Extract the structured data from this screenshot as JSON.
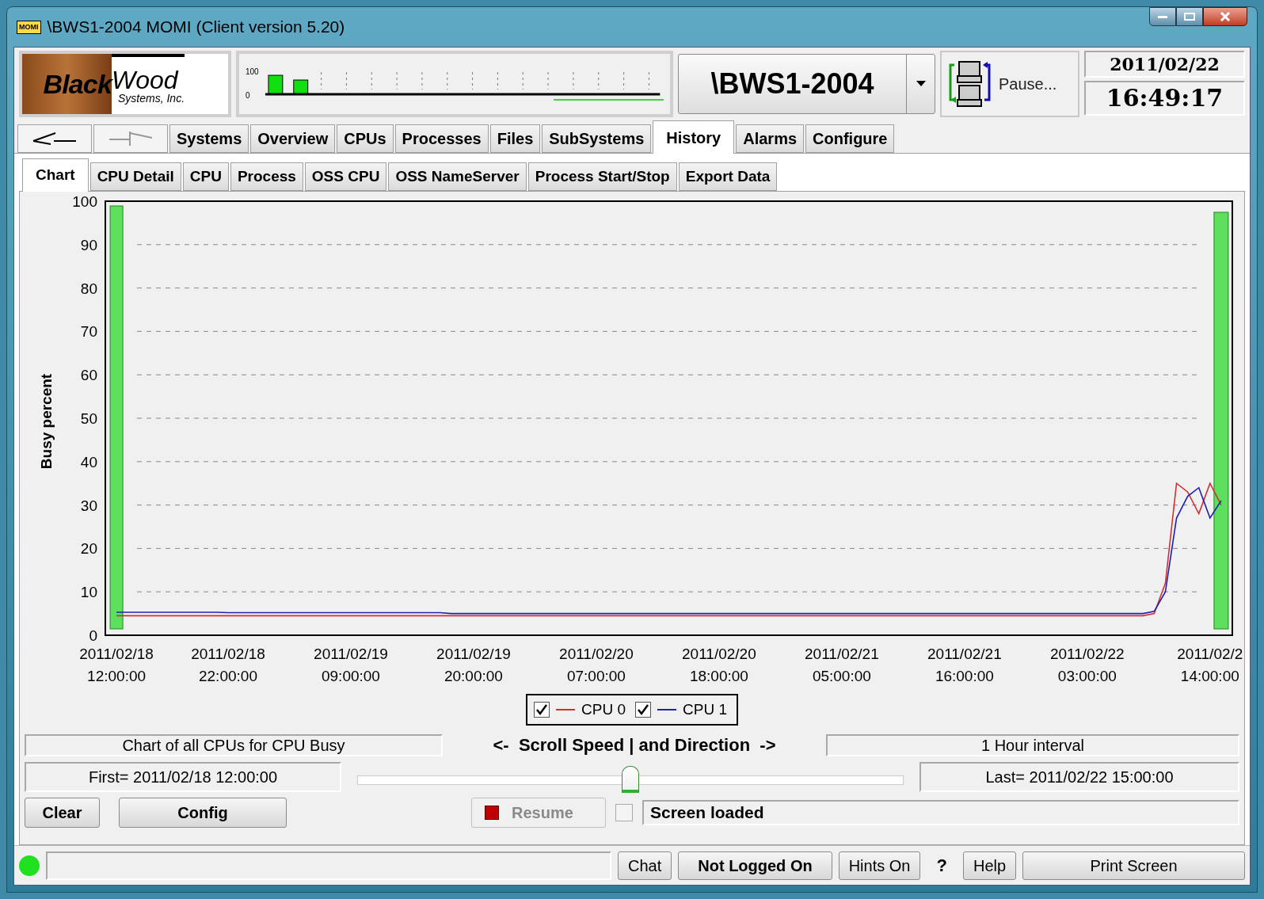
{
  "window": {
    "title": "\\BWS1-2004 MOMI (Client version 5.20)",
    "app_icon_text": "MOMI"
  },
  "header": {
    "logo": {
      "word_1": "Black",
      "word_2": "Wood",
      "tagline": "Systems, Inc."
    },
    "mini_chart": {
      "max_label": "100",
      "min_label": "0"
    },
    "system": {
      "value": "\\BWS1-2004"
    },
    "pause_button": {
      "label": "Pause..."
    },
    "date": "2011/02/22",
    "time": "16:49:17"
  },
  "tabs": [
    {
      "label": "Systems",
      "selected": false
    },
    {
      "label": "Overview",
      "selected": false
    },
    {
      "label": "CPUs",
      "selected": false
    },
    {
      "label": "Processes",
      "selected": false
    },
    {
      "label": "Files",
      "selected": false
    },
    {
      "label": "SubSystems",
      "selected": false
    },
    {
      "label": "History",
      "selected": true
    },
    {
      "label": "Alarms",
      "selected": false
    },
    {
      "label": "Configure",
      "selected": false
    }
  ],
  "subtabs": [
    {
      "label": "Chart",
      "selected": true
    },
    {
      "label": "CPU Detail",
      "selected": false
    },
    {
      "label": "CPU",
      "selected": false
    },
    {
      "label": "Process",
      "selected": false
    },
    {
      "label": "OSS CPU",
      "selected": false
    },
    {
      "label": "OSS NameServer",
      "selected": false
    },
    {
      "label": "Process Start/Stop",
      "selected": false
    },
    {
      "label": "Export Data",
      "selected": false
    }
  ],
  "legend_checkboxes": [
    {
      "checked": true
    },
    {
      "checked": true
    }
  ],
  "chart_data": {
    "type": "line",
    "grid": true,
    "legend": true,
    "ylabel": "Busy percent",
    "ylim": [
      0,
      100
    ],
    "yticks": [
      0,
      10,
      20,
      30,
      40,
      50,
      60,
      70,
      80,
      90,
      100
    ],
    "categories": [
      "2011/02/18 12:00:00",
      null,
      null,
      null,
      null,
      null,
      null,
      null,
      null,
      null,
      "2011/02/18 22:00:00",
      null,
      null,
      null,
      null,
      null,
      null,
      null,
      null,
      null,
      null,
      "2011/02/19 09:00:00",
      null,
      null,
      null,
      null,
      null,
      null,
      null,
      null,
      null,
      null,
      "2011/02/19 20:00:00",
      null,
      null,
      null,
      null,
      null,
      null,
      null,
      null,
      null,
      null,
      "2011/02/20 07:00:00",
      null,
      null,
      null,
      null,
      null,
      null,
      null,
      null,
      null,
      null,
      "2011/02/20 18:00:00",
      null,
      null,
      null,
      null,
      null,
      null,
      null,
      null,
      null,
      null,
      "2011/02/21 05:00:00",
      null,
      null,
      null,
      null,
      null,
      null,
      null,
      null,
      null,
      null,
      "2011/02/21 16:00:00",
      null,
      null,
      null,
      null,
      null,
      null,
      null,
      null,
      null,
      null,
      "2011/02/22 03:00:00",
      null,
      null,
      null,
      null,
      null,
      null,
      null,
      null,
      null,
      null,
      "2011/02/2 14:00:00",
      null
    ],
    "series": [
      {
        "name": "CPU 0",
        "color": "#d03030",
        "values": [
          4.5,
          4.5,
          4.5,
          4.5,
          4.5,
          4.5,
          4.5,
          4.5,
          4.5,
          4.5,
          4.5,
          4.5,
          4.5,
          4.5,
          4.5,
          4.5,
          4.5,
          4.5,
          4.5,
          4.5,
          4.5,
          4.5,
          4.5,
          4.5,
          4.5,
          4.5,
          4.5,
          4.5,
          4.5,
          4.5,
          4.5,
          4.5,
          4.5,
          4.5,
          4.5,
          4.5,
          4.5,
          4.5,
          4.5,
          4.5,
          4.5,
          4.5,
          4.5,
          4.5,
          4.5,
          4.5,
          4.5,
          4.5,
          4.5,
          4.5,
          4.5,
          4.5,
          4.5,
          4.5,
          4.5,
          4.5,
          4.5,
          4.5,
          4.5,
          4.5,
          4.5,
          4.5,
          4.5,
          4.5,
          4.5,
          4.5,
          4.5,
          4.5,
          4.5,
          4.5,
          4.5,
          4.5,
          4.5,
          4.5,
          4.5,
          4.5,
          4.5,
          4.5,
          4.5,
          4.5,
          4.5,
          4.5,
          4.5,
          4.5,
          4.5,
          4.5,
          4.5,
          4.5,
          4.5,
          4.5,
          4.5,
          4.5,
          4.5,
          5,
          12,
          35,
          33,
          28,
          35,
          30
        ]
      },
      {
        "name": "CPU 1",
        "color": "#2020b0",
        "values": [
          5.3,
          5.3,
          5.3,
          5.3,
          5.3,
          5.3,
          5.3,
          5.3,
          5.3,
          5.3,
          5.2,
          5.2,
          5.2,
          5.2,
          5.2,
          5.2,
          5.2,
          5.2,
          5.2,
          5.2,
          5.2,
          5.2,
          5.2,
          5.2,
          5.2,
          5.2,
          5.2,
          5.2,
          5.2,
          5.2,
          5,
          5,
          5,
          5,
          5,
          5,
          5,
          5,
          5,
          5,
          5,
          5,
          5,
          5,
          5,
          5,
          5,
          5,
          5,
          5,
          5,
          5,
          5,
          5,
          5,
          5,
          5,
          5,
          5,
          5,
          5,
          5,
          5,
          5,
          5,
          5,
          5,
          5,
          5,
          5,
          5,
          5,
          5,
          5,
          5,
          5,
          5,
          5,
          5,
          5,
          5,
          5,
          5,
          5,
          5,
          5,
          5,
          5,
          5,
          5,
          5,
          5,
          5,
          5.5,
          10,
          27,
          32,
          34,
          27,
          31
        ]
      }
    ]
  },
  "controls": {
    "caption": "Chart of all CPUs for CPU Busy",
    "scroll_label": "<-  Scroll Speed | and Direction  ->",
    "interval": "1 Hour interval",
    "first": "First= 2011/02/18 12:00:00",
    "last": "Last= 2011/02/22 15:00:00",
    "scroll": {
      "level": 0.5
    },
    "clear_button": "Clear",
    "config_button": "Config",
    "resume_button": {
      "label": "Resume",
      "disabled": true
    },
    "auto_checkbox": {
      "checked": false
    },
    "status_text": "Screen loaded"
  },
  "status_bar": {
    "connected": true,
    "buttons": [
      {
        "label": "Chat",
        "bold": false
      },
      {
        "label": "Not Logged On",
        "bold": true
      },
      {
        "label": "Hints On",
        "bold": false
      }
    ],
    "question": "?",
    "help": "Help",
    "print": "Print Screen"
  }
}
